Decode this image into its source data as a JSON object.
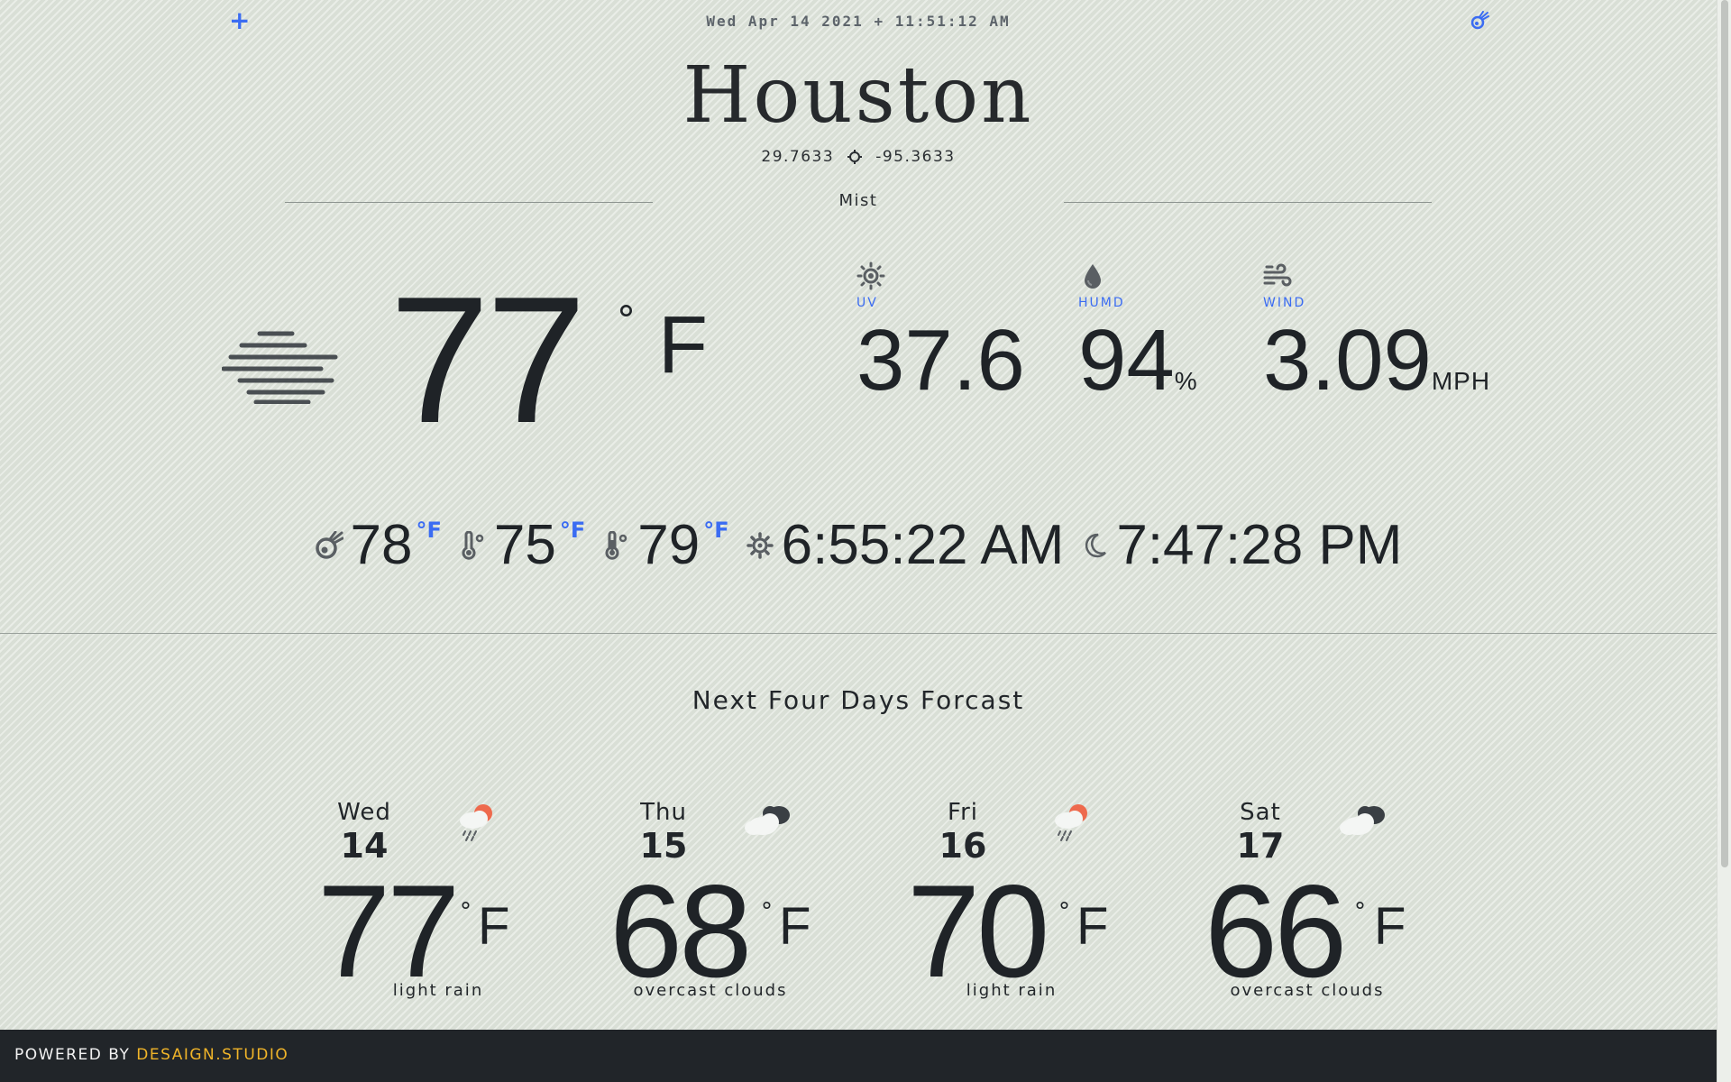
{
  "header": {
    "add_label": "+",
    "datetime": "Wed Apr 14 2021 + 11:51:12 AM",
    "settings_icon": "comet-icon"
  },
  "location": {
    "city": "Houston",
    "lat": "29.7633",
    "lon": "-95.3633",
    "condition": "Mist"
  },
  "current": {
    "icon": "mist-icon",
    "temp": "77",
    "deg": "°",
    "unit": "F",
    "stats": [
      {
        "icon": "sun-icon",
        "label": "UV",
        "value": "37.6",
        "unit": ""
      },
      {
        "icon": "droplet-icon",
        "label": "HUMD",
        "value": "94",
        "unit": "%"
      },
      {
        "icon": "wind-icon",
        "label": "WIND",
        "value": "3.09",
        "unit": "MPH"
      }
    ]
  },
  "details": {
    "feels_like": "78",
    "temp_min": "75",
    "temp_max": "79",
    "unit": "°F",
    "sunrise": "6:55:22 AM",
    "sunset": "7:47:28 PM"
  },
  "forecast": {
    "title": "Next Four Days Forcast",
    "unit_deg": "°",
    "unit_f": "F",
    "days": [
      {
        "day": "Wed",
        "date": "14",
        "temp": "77",
        "desc": "light rain",
        "icon": "rain-sun-icon"
      },
      {
        "day": "Thu",
        "date": "15",
        "temp": "68",
        "desc": "overcast clouds",
        "icon": "overcast-clouds-icon"
      },
      {
        "day": "Fri",
        "date": "16",
        "temp": "70",
        "desc": "light rain",
        "icon": "rain-sun-icon"
      },
      {
        "day": "Sat",
        "date": "17",
        "temp": "66",
        "desc": "overcast clouds",
        "icon": "overcast-clouds-icon"
      }
    ]
  },
  "footer": {
    "powered_by": "POWERED BY",
    "brand": "DESAIGN.STUDIO"
  },
  "colors": {
    "accent": "#3b6cf2",
    "brand": "#f0b429",
    "footer_bg": "#212529"
  }
}
